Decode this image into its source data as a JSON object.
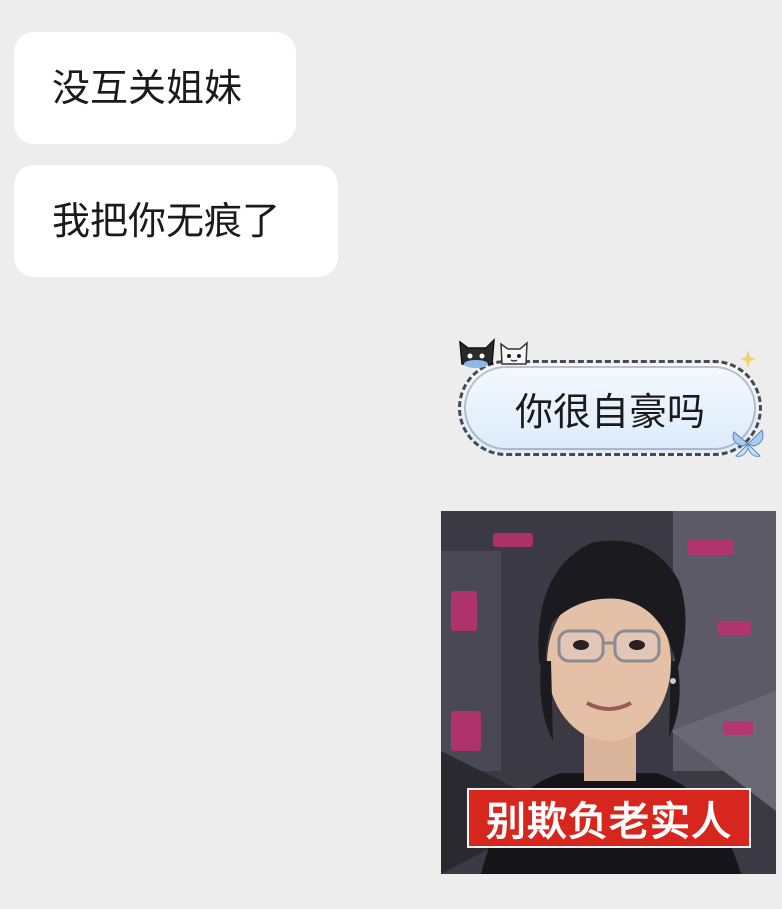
{
  "messages": [
    {
      "direction": "incoming",
      "type": "text",
      "text": "没互关姐妹"
    },
    {
      "direction": "incoming",
      "type": "text",
      "text": "我把你无痕了"
    },
    {
      "direction": "outgoing",
      "type": "text",
      "text": "你很自豪吗"
    },
    {
      "direction": "outgoing",
      "type": "image",
      "caption": "别欺负老实人"
    }
  ],
  "colors": {
    "background": "#ededed",
    "incoming_bubble": "#ffffff",
    "outgoing_bubble": "#dcebfb",
    "caption_banner": "#d7261e"
  },
  "icons": {
    "bubble_decor_1": "black-cat-sticker-icon",
    "bubble_decor_2": "white-cat-sticker-icon",
    "bubble_decor_3": "sparkle-icon",
    "bubble_decor_4": "butterfly-icon"
  }
}
